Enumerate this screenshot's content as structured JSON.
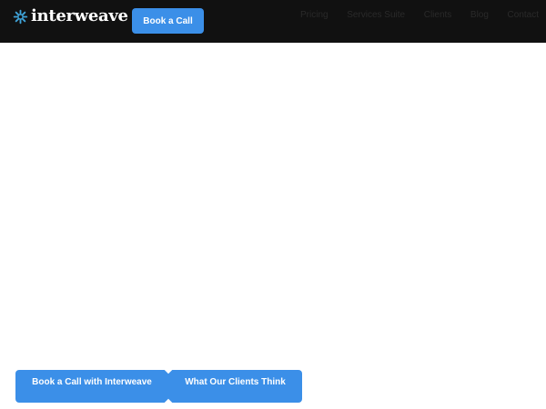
{
  "header": {
    "logo_text": "interweave",
    "logo_icon": "snowflake-knot-icon",
    "book_call_label": "Book a Call",
    "nav": [
      "Pricing",
      "Services Suite",
      "Clients",
      "Blog",
      "Contact"
    ]
  },
  "hero": {
    "primary_cta_label": "Book a Call with Interweave",
    "secondary_cta_label": "What Our Clients Think"
  },
  "colors": {
    "header_bg": "#111111",
    "accent": "#3b8fe8",
    "logo_icon": "#3fa3d8",
    "page_bg": "#ffffff"
  }
}
